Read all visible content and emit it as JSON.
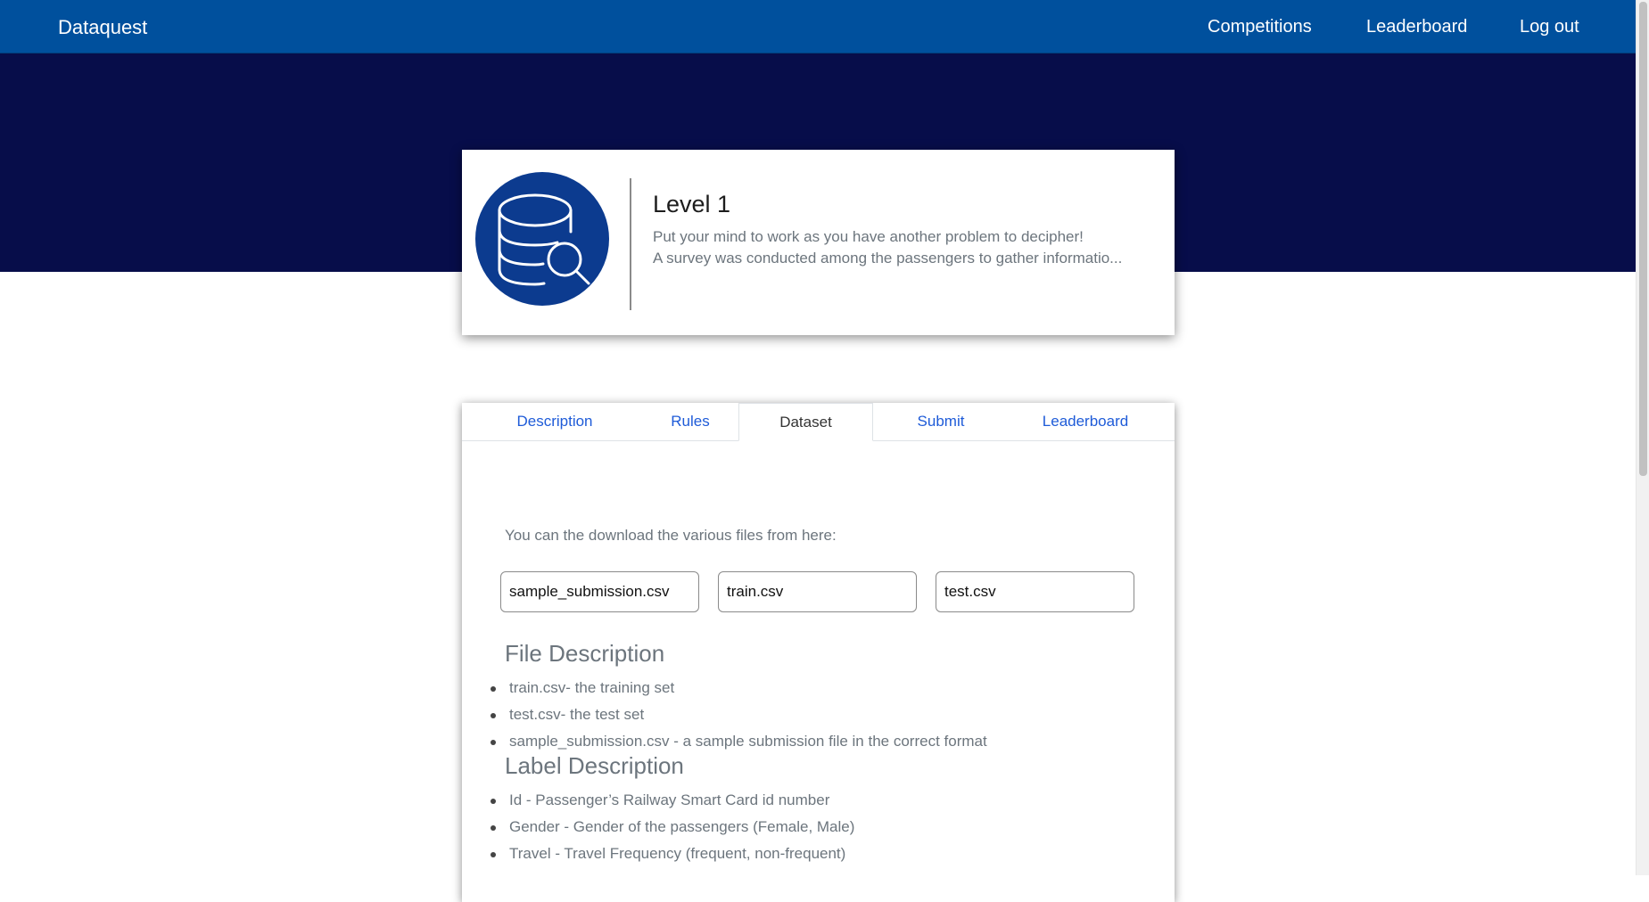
{
  "nav": {
    "brand": "Dataquest",
    "links": [
      "Competitions",
      "Leaderboard",
      "Log out"
    ]
  },
  "header": {
    "icon": "database-search-icon",
    "title": "Level 1",
    "desc_line1": "Put your mind to work as you have another problem to decipher!",
    "desc_line2": "A survey was conducted among the passengers to gather informatio..."
  },
  "tabs": [
    "Description",
    "Rules",
    "Dataset",
    "Submit",
    "Leaderboard"
  ],
  "active_tab": "Dataset",
  "dataset": {
    "intro": "You can the download the various files from here:",
    "files": [
      "sample_submission.csv",
      "train.csv",
      "test.csv"
    ],
    "file_description_title": "File Description",
    "file_description": [
      "train.csv- the training set",
      "test.csv- the test set",
      "sample_submission.csv - a sample submission file in the correct format"
    ],
    "label_description_title": "Label Description",
    "label_description": [
      "Id - Passenger’s Railway Smart Card id number",
      "Gender - Gender of the passengers (Female, Male)",
      "Travel - Travel Frequency (frequent, non-frequent)"
    ]
  },
  "colors": {
    "navbar": "#00509d",
    "hero": "#070d4a",
    "logo_circle": "#0c3b8f",
    "tab_link": "#1e5bd8"
  }
}
